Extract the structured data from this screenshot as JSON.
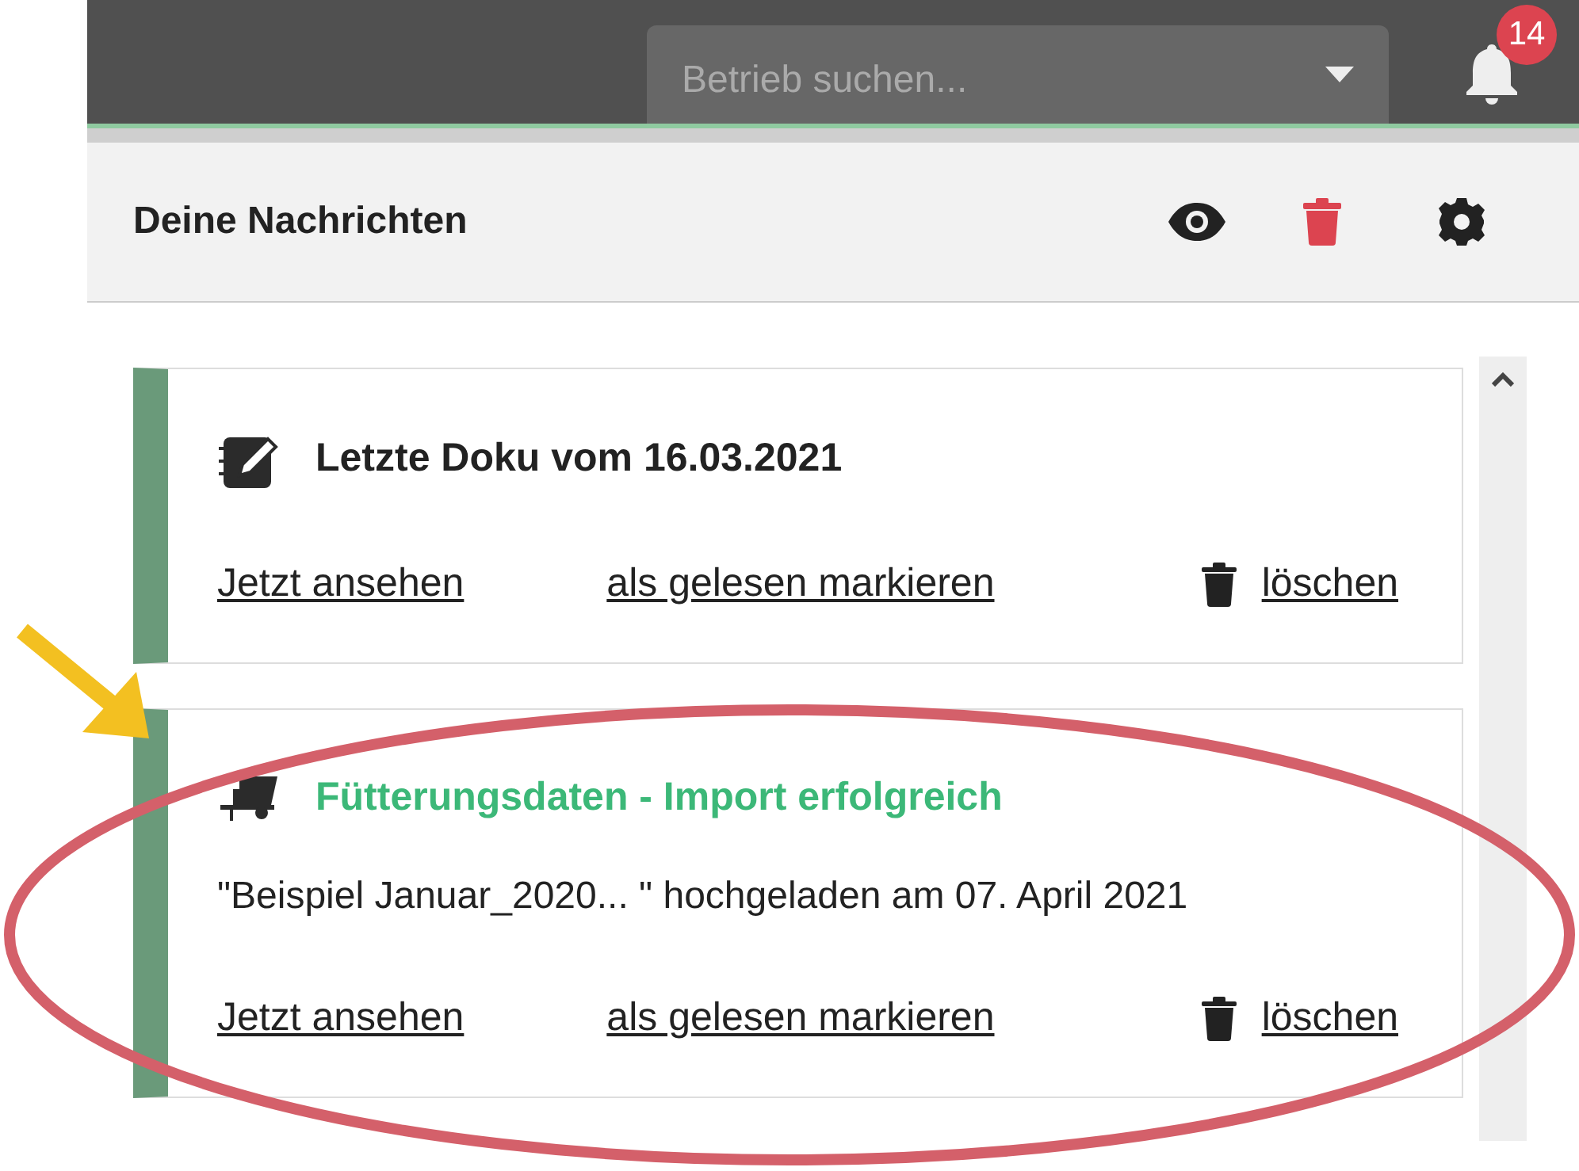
{
  "top_bar": {
    "search": {
      "placeholder": "Betrieb suchen..."
    },
    "notifications": {
      "count": "14"
    }
  },
  "header": {
    "title": "Deine Nachrichten"
  },
  "messages": [
    {
      "kind": "doku",
      "title": "Letzte Doku vom 16.03.2021",
      "color": "#222222",
      "actions": [
        {
          "kind": "view",
          "label": "Jetzt ansehen"
        },
        {
          "kind": "mark",
          "label": "als gelesen markieren"
        },
        {
          "kind": "delete",
          "label": "löschen"
        }
      ]
    },
    {
      "kind": "feeding",
      "title": "Fütterungsdaten - Import erfolgreich",
      "color": "#3cb878",
      "description": "\"Beispiel Januar_2020... \" hochgeladen am 07. April 2021",
      "actions": [
        {
          "kind": "view",
          "label": "Jetzt ansehen"
        },
        {
          "kind": "mark",
          "label": "als gelesen markieren"
        },
        {
          "kind": "delete",
          "label": "löschen"
        }
      ]
    }
  ]
}
